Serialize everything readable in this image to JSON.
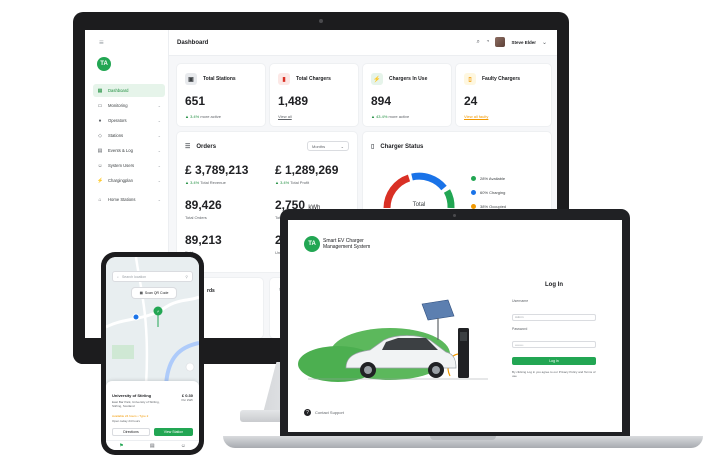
{
  "colors": {
    "brand": "#22a653",
    "available": "#22a653",
    "charging": "#1a73e8",
    "occupied": "#f29900",
    "faulty": "#d93025"
  },
  "desktop": {
    "logo": "TA",
    "page_title": "Dashboard",
    "user_name": "Steve Elder",
    "nav": [
      {
        "label": "Dashboard",
        "icon": "grid-icon"
      },
      {
        "label": "Monitoring",
        "icon": "monitor-icon"
      },
      {
        "label": "Operators",
        "icon": "users-icon"
      },
      {
        "label": "Stations",
        "icon": "station-icon"
      },
      {
        "label": "Events & Log",
        "icon": "log-icon"
      },
      {
        "label": "System Users",
        "icon": "person-icon"
      },
      {
        "label": "Chargingplan",
        "icon": "plug-icon"
      },
      {
        "label": "Home Stations",
        "icon": "home-icon"
      }
    ],
    "stats": [
      {
        "title": "Total Stations",
        "value": "651",
        "sub_prefix": "▲ 3.4%",
        "sub": "more active",
        "icon": "station-icon"
      },
      {
        "title": "Total Chargers",
        "value": "1,489",
        "sub_prefix": "",
        "sub": "View all",
        "icon": "charger-icon"
      },
      {
        "title": "Chargers In Use",
        "value": "894",
        "sub_prefix": "▲ 43.4%",
        "sub": "more active",
        "icon": "plug-icon"
      },
      {
        "title": "Faulty Chargers",
        "value": "24",
        "sub_prefix": "",
        "sub": "View all faulty",
        "icon": "warning-icon"
      }
    ],
    "orders": {
      "title": "Orders",
      "period": "Months",
      "cells": [
        {
          "value": "£ 3,789,213",
          "prefix": "▲ 3.4%",
          "label": "Total Revenue"
        },
        {
          "value": "£ 1,289,269",
          "prefix": "▲ 3.4%",
          "label": "Total Profit"
        },
        {
          "value": "89,426",
          "prefix": "",
          "label": "Total Orders"
        },
        {
          "value": "2,750",
          "unit": "kWh",
          "prefix": "",
          "label": "Total"
        },
        {
          "value": "89,213",
          "prefix": "",
          "label": "Paid"
        },
        {
          "value": "237",
          "prefix": "",
          "label": "Un"
        }
      ]
    },
    "charger_status": {
      "title": "Charger Status",
      "center_label": "Total",
      "center_value": "894",
      "legend": [
        {
          "label": "28% Available",
          "color": "#22a653"
        },
        {
          "label": "60% Charging",
          "color": "#1a73e8"
        },
        {
          "label": "38% Occupied",
          "color": "#f29900"
        }
      ]
    },
    "bottom_cards": [
      "rds",
      ""
    ]
  },
  "laptop": {
    "logo": "TA",
    "brand_line1": "Smart EV Charger",
    "brand_line2": "Management System",
    "login_title": "Log In",
    "username_label": "Username",
    "username_value": "Admin",
    "password_label": "Password",
    "password_value": "••••••••",
    "login_button": "Log in",
    "note": "By clicking Log in you agree to our Privacy Policy and Terms of use",
    "help": "Contact Support"
  },
  "phone": {
    "search_placeholder": "Search location",
    "qr_label": "Scan QR Code",
    "location_name": "University of Stirling",
    "price": "£ 0.30",
    "price_unit": "Per kWh",
    "address": "East Bar Park, University of Stirling, Stirling, Scotland",
    "availability": "Available 24 hours • Type 2",
    "hours": "Open today 24 hours",
    "btn_directions": "Directions",
    "btn_view": "View Station"
  }
}
